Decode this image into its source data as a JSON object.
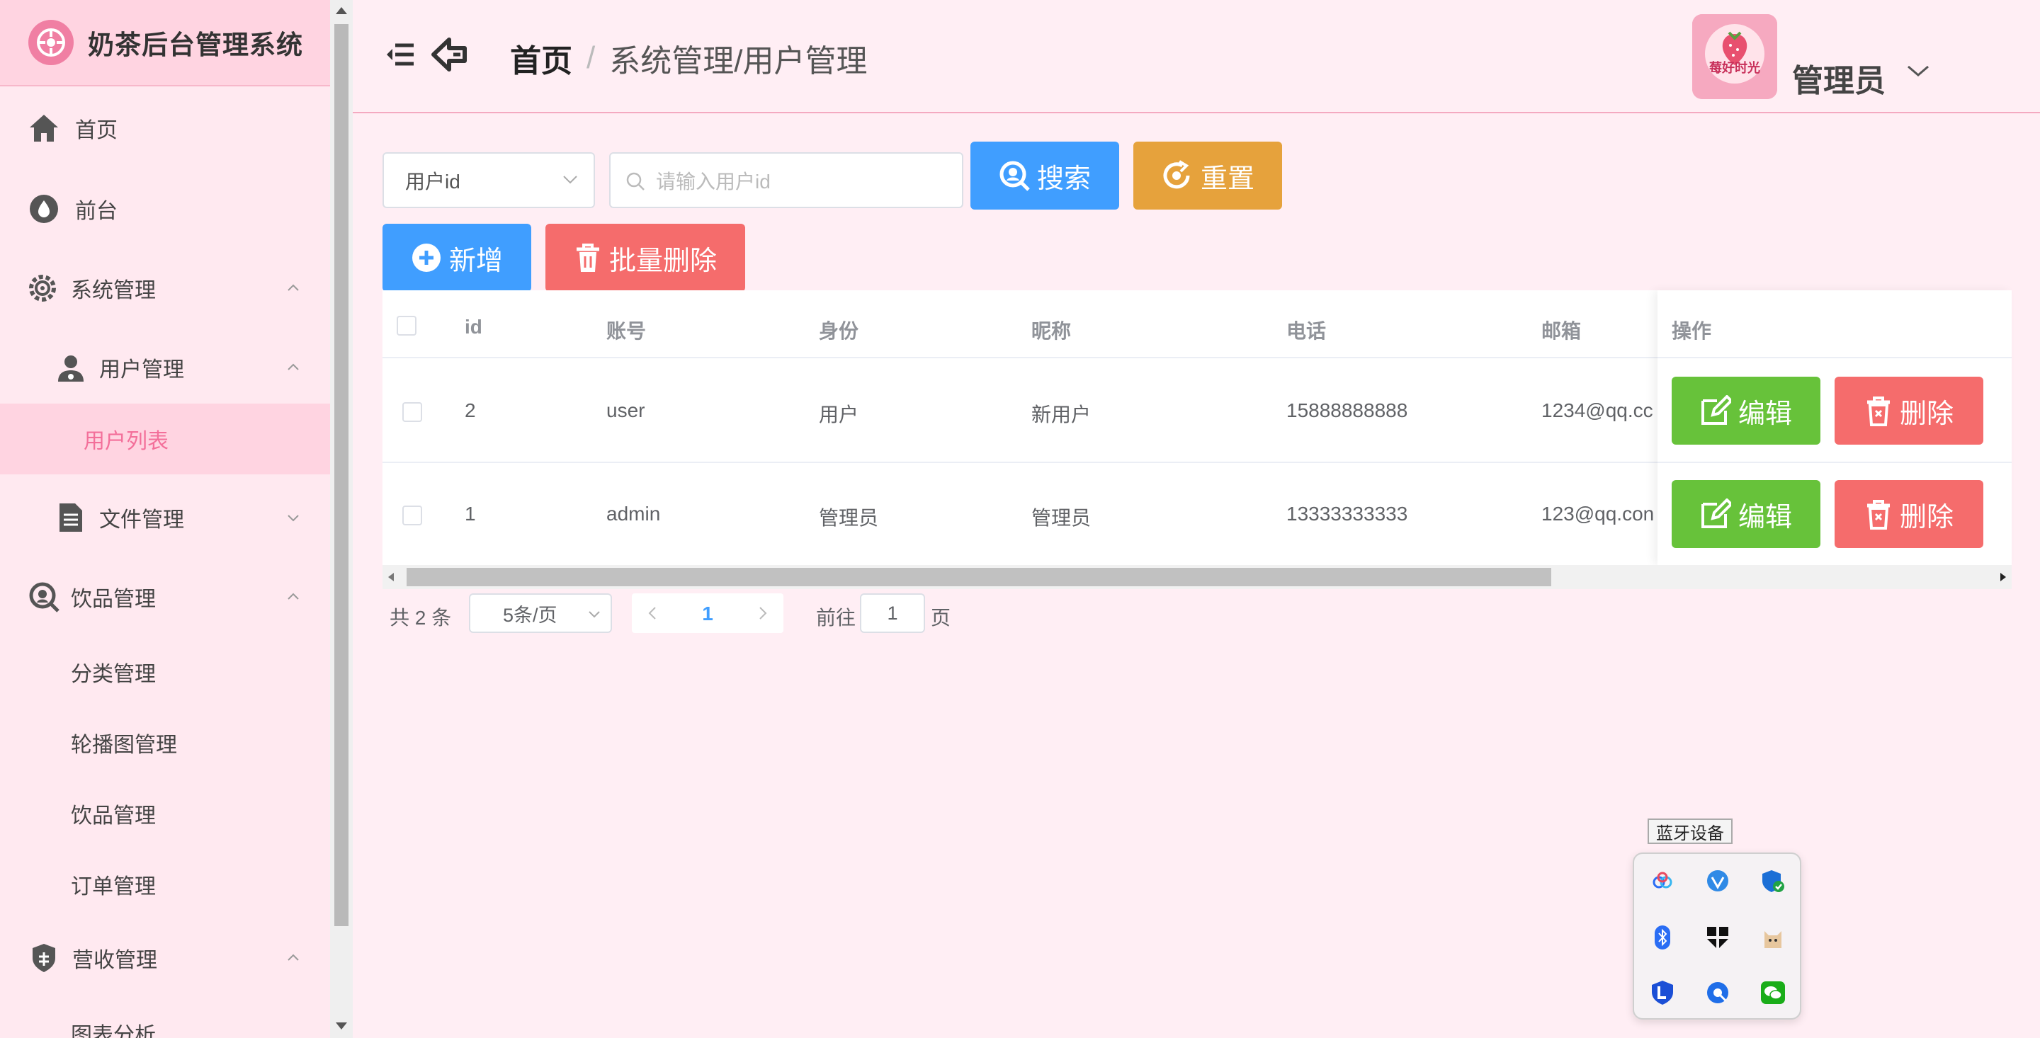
{
  "sidebar": {
    "title": "奶茶后台管理系统",
    "items": [
      {
        "label": "首页",
        "icon": "home-icon"
      },
      {
        "label": "前台",
        "icon": "drop-icon"
      },
      {
        "label": "系统管理",
        "icon": "gear-icon"
      },
      {
        "label": "用户管理",
        "icon": "user-icon"
      },
      {
        "label": "用户列表",
        "icon": "",
        "active": true
      },
      {
        "label": "文件管理",
        "icon": "file-icon"
      },
      {
        "label": "饮品管理",
        "icon": "search-circle-icon"
      },
      {
        "label": "分类管理"
      },
      {
        "label": "轮播图管理"
      },
      {
        "label": "饮品管理"
      },
      {
        "label": "订单管理"
      },
      {
        "label": "营收管理",
        "icon": "shield-icon"
      },
      {
        "label": "图表分析"
      }
    ]
  },
  "header": {
    "breadcrumb_home": "首页",
    "breadcrumb_sep": "/",
    "breadcrumb_current": "系统管理/用户管理",
    "avatar_text": "莓好时光",
    "user_name": "管理员"
  },
  "toolbar": {
    "select_value": "用户id",
    "search_placeholder": "请输入用户id",
    "search_label": "搜索",
    "reset_label": "重置",
    "add_label": "新增",
    "batch_delete_label": "批量删除"
  },
  "table": {
    "columns": [
      "id",
      "账号",
      "身份",
      "昵称",
      "电话",
      "邮箱",
      "操作"
    ],
    "rows": [
      {
        "id": "2",
        "account": "user",
        "role": "用户",
        "nickname": "新用户",
        "phone": "15888888888",
        "email": "1234@qq.cc"
      },
      {
        "id": "1",
        "account": "admin",
        "role": "管理员",
        "nickname": "管理员",
        "phone": "13333333333",
        "email": "123@qq.con"
      }
    ],
    "edit_label": "编辑",
    "delete_label": "删除"
  },
  "pagination": {
    "total": "共 2 条",
    "page_size": "5条/页",
    "current_page": "1",
    "goto_label": "前往",
    "goto_value": "1",
    "page_suffix": "页"
  },
  "tray": {
    "tooltip": "蓝牙设备",
    "icons": [
      "baidu-netdisk-icon",
      "browser-icon",
      "security-shield-icon",
      "bluetooth-icon",
      "app-grid-icon",
      "cat-icon",
      "lenovo-icon",
      "qq-browser-icon",
      "wechat-icon"
    ]
  },
  "colors": {
    "accent_pink": "#f36f9a",
    "primary_blue": "#409eff",
    "warning_orange": "#e6a23c",
    "danger_red": "#f56c6c",
    "success_green": "#67c23a"
  }
}
